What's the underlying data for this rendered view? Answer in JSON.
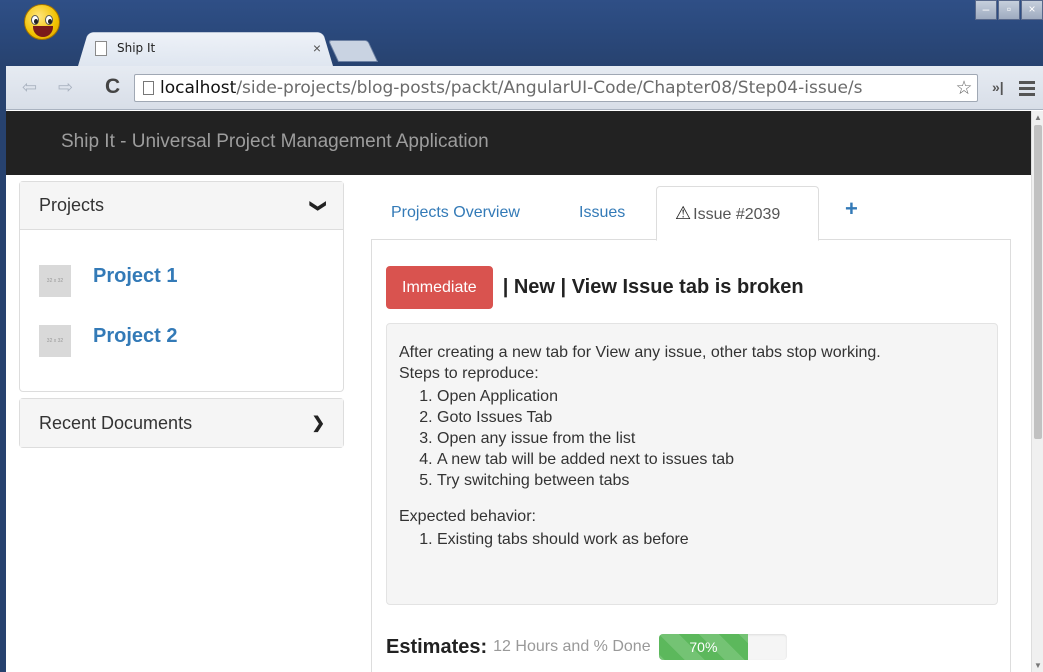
{
  "browser": {
    "tab_title": "Ship It",
    "tab_close": "×",
    "url_host": "localhost",
    "url_path": "/side-projects/blog-posts/packt/AngularUI-Code/Chapter08/Step04-issue/s",
    "win_minimize": "–",
    "win_maximize": "▫",
    "win_close": "×",
    "back_icon": "⇦",
    "forward_icon": "⇨",
    "reload_icon": "C",
    "star_icon": "☆",
    "extend_icon": "»|"
  },
  "navbar": {
    "brand": "Ship It - Universal Project Management Application"
  },
  "sidebar": {
    "projects_title": "Projects",
    "projects_chevron": "❯",
    "projects": [
      {
        "label": "Project 1",
        "thumb": "32 x 32"
      },
      {
        "label": "Project 2",
        "thumb": "32 x 32"
      }
    ],
    "recent_title": "Recent Documents",
    "recent_chevron": "❯"
  },
  "tabs": {
    "overview": "Projects Overview",
    "issues": "Issues",
    "issue_tab": "Issue #2039",
    "warning_icon": "⚠",
    "add": "+"
  },
  "issue": {
    "priority": "Immediate",
    "title": "| New | View Issue tab is broken",
    "intro": "After creating a new tab for View any issue, other tabs stop working.",
    "steps_label": "Steps to reproduce:",
    "steps": [
      "Open Application",
      "Goto Issues Tab",
      "Open any issue from the list",
      "A new tab will be added next to issues tab",
      "Try switching between tabs"
    ],
    "expected_label": "Expected behavior:",
    "expected": [
      "Existing tabs should work as before"
    ],
    "estimates_label": "Estimates:",
    "estimates_text": "12 Hours and % Done",
    "progress_label": "70%",
    "progress_value": 0.7
  },
  "colors": {
    "navbar": "#222222",
    "link": "#337ab7",
    "badge": "#d9534f",
    "progress": "#5cb85c"
  }
}
